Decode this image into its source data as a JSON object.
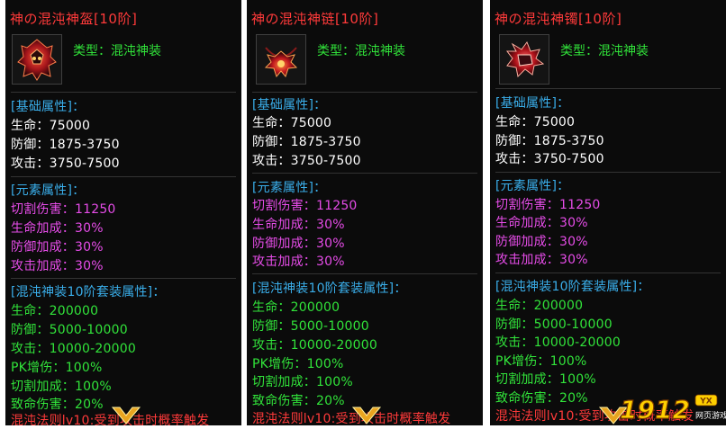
{
  "colors": {
    "title": "#ff3434",
    "header": "#3aaeea",
    "base_text": "#ffffff",
    "element_text": "#e64ce8",
    "set_text": "#31e33a",
    "footer_text": "#ff3a3a",
    "panel_bg": "#0b0b0b"
  },
  "items": [
    {
      "title": "神の混沌神盔[10阶]",
      "icon": "helmet-icon",
      "type": "类型：混沌神装",
      "base_header": "[基础属性]：",
      "base_stats": [
        "生命：75000",
        "防御：1875-3750",
        "攻击：3750-7500"
      ],
      "element_header": "[元素属性]：",
      "element_stats": [
        "切割伤害：11250",
        "生命加成：30%",
        "防御加成：30%",
        "攻击加成：30%"
      ],
      "set_header": "[混沌神装10阶套装属性]：",
      "set_stats": [
        "生命：200000",
        "防御：5000-10000",
        "攻击：10000-20000",
        "PK增伤：100%",
        "切割加成：100%",
        "致命伤害：20%"
      ],
      "footer": "混沌法则lv10:受到攻击时概率触发"
    },
    {
      "title": "神の混沌神链[10阶]",
      "icon": "necklace-icon",
      "type": "类型：混沌神装",
      "base_header": "[基础属性]：",
      "base_stats": [
        "生命：75000",
        "防御：1875-3750",
        "攻击：3750-7500"
      ],
      "element_header": "[元素属性]：",
      "element_stats": [
        "切割伤害：11250",
        "生命加成：30%",
        "防御加成：30%",
        "攻击加成：30%"
      ],
      "set_header": "[混沌神装10阶套装属性]：",
      "set_stats": [
        "生命：200000",
        "防御：5000-10000",
        "攻击：10000-20000",
        "PK增伤：100%",
        "切割加成：100%",
        "致命伤害：20%"
      ],
      "footer": "混沌法则lv10:受到攻击时概率触发"
    },
    {
      "title": "神の混沌神镯[10阶]",
      "icon": "bracelet-icon",
      "type": "类型：混沌神装",
      "base_header": "[基础属性]：",
      "base_stats": [
        "生命：75000",
        "防御：1875-3750",
        "攻击：3750-7500"
      ],
      "element_header": "[元素属性]：",
      "element_stats": [
        "切割伤害：11250",
        "生命加成：30%",
        "防御加成：30%",
        "攻击加成：30%"
      ],
      "set_header": "[混沌神装10阶套装属性]：",
      "set_stats": [
        "生命：200000",
        "防御：5000-10000",
        "攻击：10000-20000",
        "PK增伤：100%",
        "切割加成：100%",
        "致命伤害：20%"
      ],
      "footer": "混沌法则lv10:受到攻击时概率触发"
    }
  ],
  "watermark": {
    "number": "1912",
    "badge": "YX",
    "sub": "网页游戏"
  }
}
